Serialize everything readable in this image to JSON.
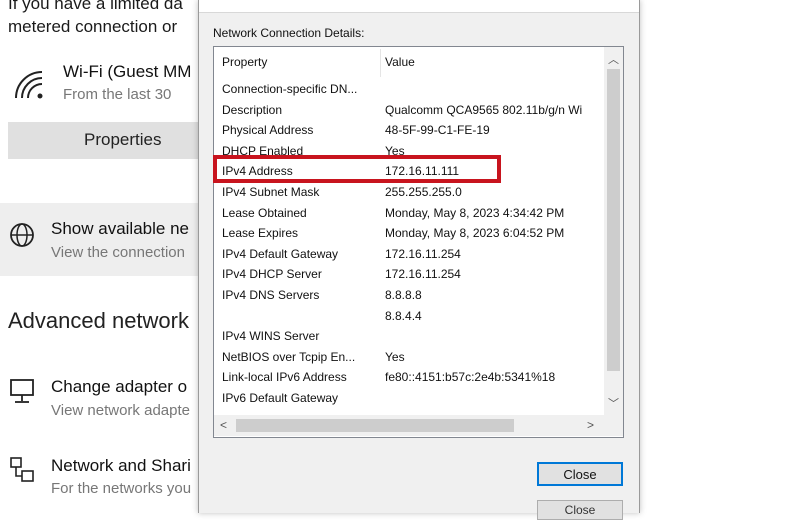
{
  "background": {
    "intro_line1": "If you have a limited da",
    "intro_line2": "metered connection or",
    "wifi": {
      "title": "Wi-Fi (Guest MM",
      "subtitle": "From the last 30"
    },
    "properties_label": "Properties",
    "show_available": {
      "title": "Show available ne",
      "subtitle": "View the connection"
    },
    "advanced_heading": "Advanced network",
    "change_adapter": {
      "title": "Change adapter o",
      "subtitle": "View network adapte"
    },
    "network_sharing": {
      "title": "Network and Shari",
      "subtitle": "For the networks you"
    }
  },
  "dialog": {
    "details_label": "Network Connection Details:",
    "columns": {
      "property": "Property",
      "value": "Value"
    },
    "rows": [
      {
        "property": "Connection-specific DN...",
        "value": ""
      },
      {
        "property": "Description",
        "value": "Qualcomm QCA9565 802.11b/g/n Wi"
      },
      {
        "property": "Physical Address",
        "value": "48-5F-99-C1-FE-19"
      },
      {
        "property": "DHCP Enabled",
        "value": "Yes"
      },
      {
        "property": "IPv4 Address",
        "value": "172.16.11.111"
      },
      {
        "property": "IPv4 Subnet Mask",
        "value": "255.255.255.0"
      },
      {
        "property": "Lease Obtained",
        "value": "Monday, May 8, 2023 4:34:42 PM"
      },
      {
        "property": "Lease Expires",
        "value": "Monday, May 8, 2023 6:04:52 PM"
      },
      {
        "property": "IPv4 Default Gateway",
        "value": "172.16.11.254"
      },
      {
        "property": "IPv4 DHCP Server",
        "value": "172.16.11.254"
      },
      {
        "property": "IPv4 DNS Servers",
        "value": "8.8.8.8"
      },
      {
        "property": "",
        "value": "8.8.4.4"
      },
      {
        "property": "IPv4 WINS Server",
        "value": ""
      },
      {
        "property": "NetBIOS over Tcpip En...",
        "value": "Yes"
      },
      {
        "property": "Link-local IPv6 Address",
        "value": "fe80::4151:b57c:2e4b:5341%18"
      },
      {
        "property": "IPv6 Default Gateway",
        "value": ""
      }
    ],
    "close_label": "Close",
    "close_ghost_label": "Close",
    "highlight_color": "#c8141e",
    "accent_color": "#0078d7"
  }
}
